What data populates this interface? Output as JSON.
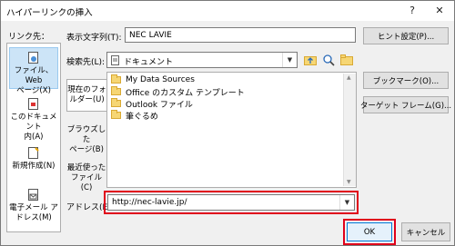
{
  "dialog": {
    "title": "ハイパーリンクの挿入",
    "help": "?",
    "close": "✕"
  },
  "link_to": {
    "label": "リンク先：",
    "items": [
      {
        "label1": "ファイル、Web",
        "label2": "ページ(X)",
        "icon": "web-page-icon"
      },
      {
        "label1": "このドキュメント",
        "label2": "内(A)",
        "icon": "document-place-icon"
      },
      {
        "label1": "新規作成(N)",
        "label2": "",
        "icon": "new-document-icon"
      },
      {
        "label1": "電子メール ア",
        "label2": "ドレス(M)",
        "icon": "email-address-icon"
      }
    ]
  },
  "display_text": {
    "label": "表示文字列(T):",
    "value": "NEC LAVIE"
  },
  "screen_tip_button": "ヒント設定(P)...",
  "look_in": {
    "label": "検索先(L):",
    "value": "ドキュメント"
  },
  "nav": [
    {
      "label1": "現在のフォ",
      "label2": "ルダー(U)"
    },
    {
      "label1": "ブラウズした",
      "label2": "ページ(B)"
    },
    {
      "label1": "最近使った",
      "label2": "ファイル(C)"
    }
  ],
  "files": [
    "My Data Sources",
    "Office のカスタム テンプレート",
    "Outlook ファイル",
    "筆ぐるめ"
  ],
  "bookmark_button": "ブックマーク(O)...",
  "target_frame_button": "ターゲット フレーム(G)...",
  "address": {
    "label": "アドレス(E):",
    "value": "http://nec-lavie.jp/"
  },
  "ok_button": "OK",
  "cancel_button": "キャンセル",
  "colors": {
    "highlight": "#e0001b",
    "selection": "#cce4f7"
  }
}
